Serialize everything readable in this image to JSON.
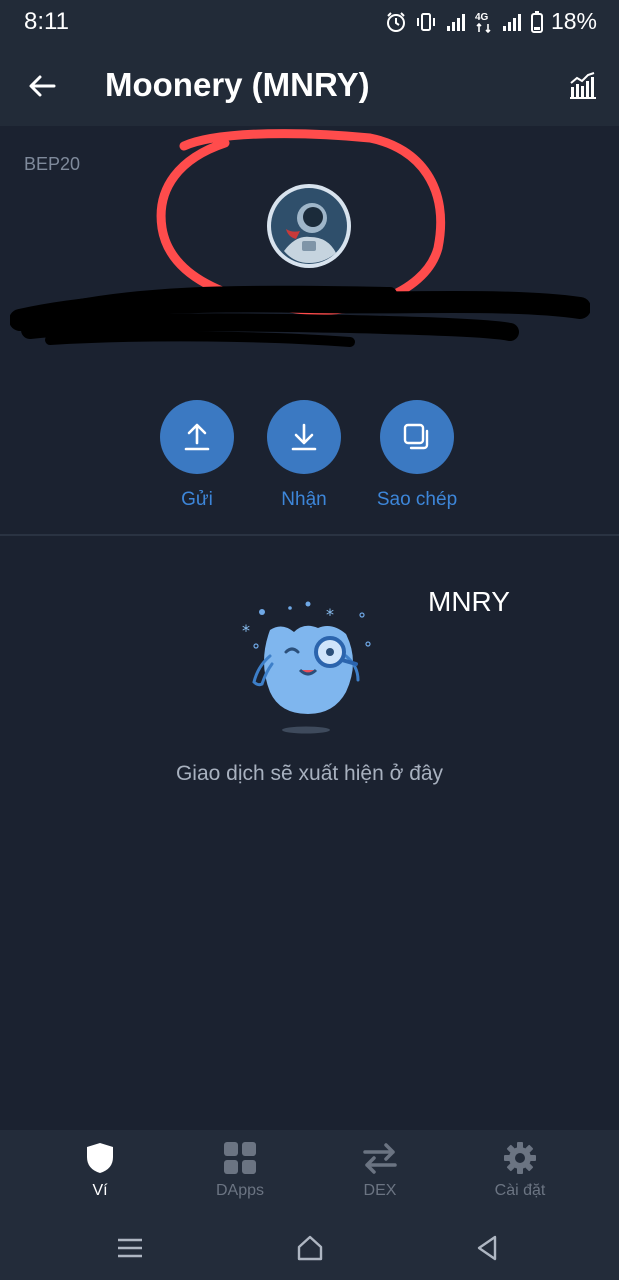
{
  "status_bar": {
    "time": "8:11",
    "battery": "18%",
    "network_type": "4G"
  },
  "header": {
    "title": "Moonery (MNRY)",
    "back_icon": "arrow-left-icon",
    "chart_icon": "bar-chart-icon"
  },
  "token": {
    "network": "BEP20",
    "balance_suffix": "MNRY",
    "logo_icon": "astronaut-logo-icon"
  },
  "actions": [
    {
      "label": "Gửi",
      "icon": "upload-icon"
    },
    {
      "label": "Nhận",
      "icon": "download-icon"
    },
    {
      "label": "Sao chép",
      "icon": "copy-icon"
    }
  ],
  "empty_state": {
    "message": "Giao dịch sẽ xuất hiện ở đây"
  },
  "bottom_nav": [
    {
      "label": "Ví",
      "icon": "shield-icon",
      "active": true
    },
    {
      "label": "DApps",
      "icon": "grid-icon",
      "active": false
    },
    {
      "label": "DEX",
      "icon": "swap-icon",
      "active": false
    },
    {
      "label": "Cài đặt",
      "icon": "gear-icon",
      "active": false
    }
  ],
  "colors": {
    "background": "#1b2230",
    "accent": "#3b79c2",
    "annotation": "#ff4c4c"
  }
}
